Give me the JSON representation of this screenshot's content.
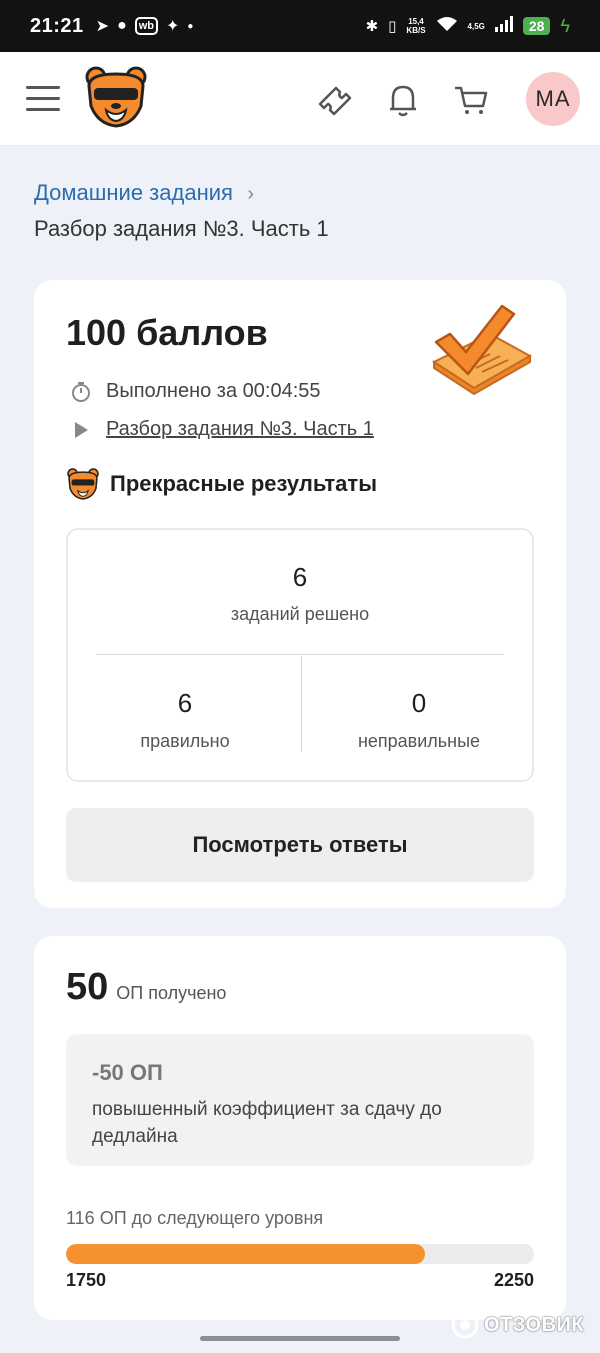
{
  "status_bar": {
    "time": "21:21",
    "speed_value": "15,4",
    "speed_unit": "KB/S",
    "network": "4,5G",
    "battery": "28"
  },
  "header": {
    "avatar_initials": "MA"
  },
  "breadcrumb": {
    "parent": "Домашние задания",
    "current": "Разбор задания №3. Часть 1"
  },
  "result_card": {
    "score": "100 баллов",
    "completed_time": "Выполнено за 00:04:55",
    "task_link": "Разбор задания №3. Часть 1",
    "result_label": "Прекрасные результаты",
    "stats": {
      "total_value": "6",
      "total_label": "заданий решено",
      "correct_value": "6",
      "correct_label": "правильно",
      "incorrect_value": "0",
      "incorrect_label": "неправильные"
    },
    "answers_button": "Посмотреть ответы"
  },
  "points_card": {
    "points_value": "50",
    "points_label": "ОП получено",
    "penalty_value": "-50 ОП",
    "penalty_text": "повышенный коэффициент за сдачу до дедлайна",
    "next_level_text": "116 ОП до следующего уровня",
    "level_min": "1750",
    "level_max": "2250",
    "progress_fraction": 0.768
  },
  "colors": {
    "accent": "#f6912f",
    "link": "#2b6cb0",
    "avatar_bg": "#f9c9c9"
  },
  "watermark": "ОТЗОВИК"
}
